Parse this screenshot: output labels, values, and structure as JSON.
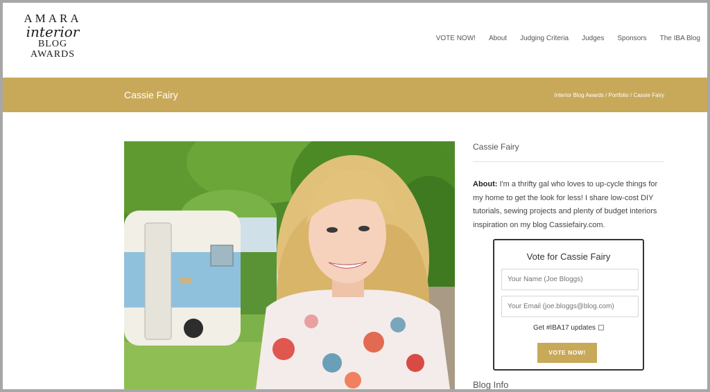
{
  "logo": {
    "line1": "AMARA",
    "line2": "interior",
    "line3": "BLOG",
    "line4": "AWARDS"
  },
  "nav": {
    "items": [
      "VOTE NOW!",
      "About",
      "Judging Criteria",
      "Judges",
      "Sponsors",
      "The IBA Blog"
    ]
  },
  "title_bar": {
    "title": "Cassie Fairy",
    "breadcrumb": "Interior Blog Awards / Portfolio / Cassie Fairy"
  },
  "sidebar": {
    "name": "Cassie Fairy",
    "about_label": "About:",
    "about_text": " I'm a thrifty gal who loves to up-cycle things for my home to get the look for less! I share low-cost DIY tutorials, sewing projects and plenty of budget interiors inspiration on my blog Cassiefairy.com.",
    "vote": {
      "title": "Vote for Cassie Fairy",
      "name_placeholder": "Your Name (Joe Bloggs)",
      "email_placeholder": "Your Email (joe.bloggs@blog.com)",
      "updates_label": "Get #IBA17 updates",
      "button_label": "VOTE NOW!"
    },
    "blog_info_heading": "Blog Info"
  },
  "colors": {
    "accent": "#c8a95a",
    "frame": "#a7a7a7"
  }
}
